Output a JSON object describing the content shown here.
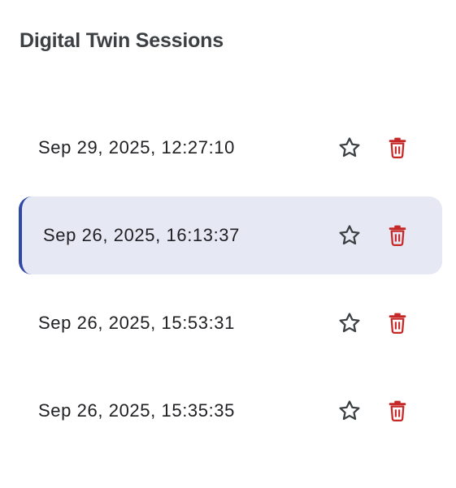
{
  "panel": {
    "title": "Digital Twin Sessions"
  },
  "sessions": [
    {
      "label": "Sep 29, 2025, 12:27:10",
      "selected": false,
      "star_icon": "star-outline-icon",
      "delete_icon": "trash-icon"
    },
    {
      "label": "Sep 26, 2025, 16:13:37",
      "selected": true,
      "star_icon": "star-outline-icon",
      "delete_icon": "trash-icon"
    },
    {
      "label": "Sep 26, 2025, 15:53:31",
      "selected": false,
      "star_icon": "star-outline-icon",
      "delete_icon": "trash-icon"
    },
    {
      "label": "Sep 26, 2025, 15:35:35",
      "selected": false,
      "star_icon": "star-outline-icon",
      "delete_icon": "trash-icon"
    }
  ],
  "colors": {
    "selected_background": "#e6e8f3",
    "selected_accent": "#2f48a8",
    "delete_icon": "#c62828",
    "star_icon": "#3c4043",
    "title_text": "#3c4043"
  }
}
